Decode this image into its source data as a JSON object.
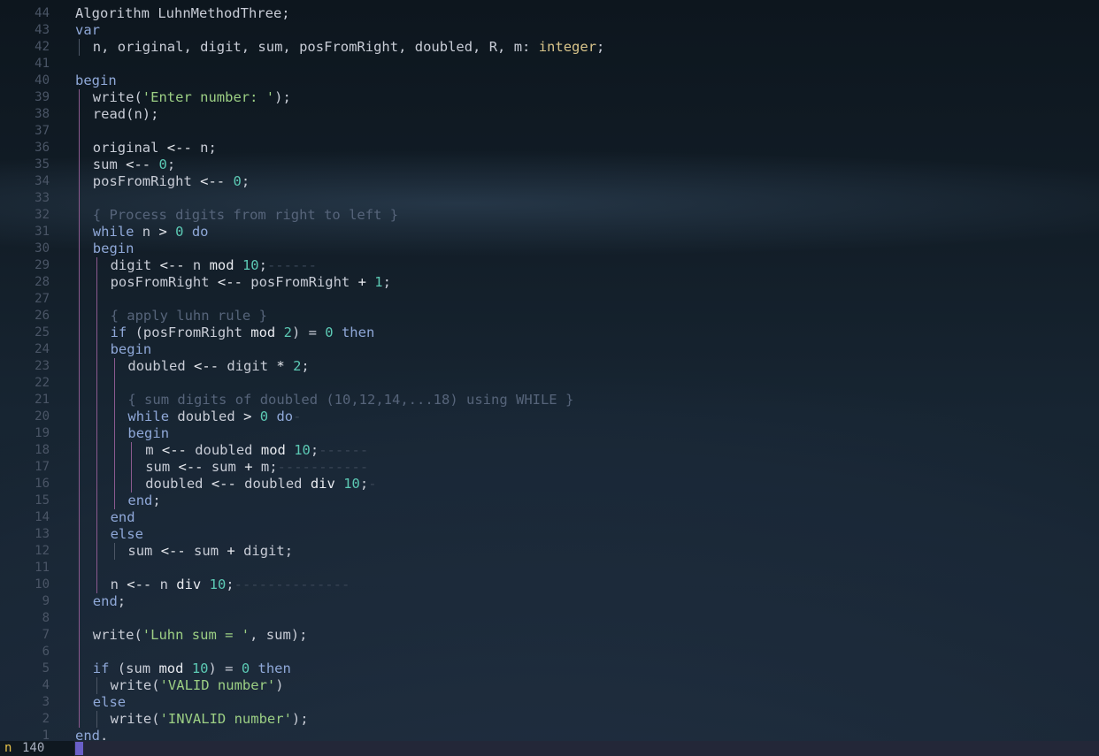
{
  "editor": {
    "lines": [
      {
        "num": "44",
        "indent": 0,
        "guides": [],
        "tokens": [
          [
            "pl",
            "Algorithm LuhnMethodThree;"
          ]
        ]
      },
      {
        "num": "43",
        "indent": 0,
        "guides": [],
        "tokens": [
          [
            "kw",
            "var"
          ]
        ]
      },
      {
        "num": "42",
        "indent": 1,
        "guides": [
          "grey"
        ],
        "tokens": [
          [
            "pl",
            "n, original, digit, sum, posFromRight, doubled, R, m: "
          ],
          [
            "ty",
            "integer"
          ],
          [
            "pl",
            ";"
          ]
        ]
      },
      {
        "num": "41",
        "indent": 0,
        "guides": [],
        "tokens": []
      },
      {
        "num": "40",
        "indent": 0,
        "guides": [],
        "tokens": [
          [
            "kw",
            "begin"
          ]
        ]
      },
      {
        "num": "39",
        "indent": 1,
        "guides": [
          "purple"
        ],
        "tokens": [
          [
            "pl",
            "write("
          ],
          [
            "str",
            "'Enter number: '"
          ],
          [
            "pl",
            ");"
          ]
        ]
      },
      {
        "num": "38",
        "indent": 1,
        "guides": [
          "purple"
        ],
        "tokens": [
          [
            "pl",
            "read(n);"
          ]
        ]
      },
      {
        "num": "37",
        "indent": 1,
        "guides": [
          "purple"
        ],
        "tokens": []
      },
      {
        "num": "36",
        "indent": 1,
        "guides": [
          "purple"
        ],
        "tokens": [
          [
            "pl",
            "original "
          ],
          [
            "op",
            "<--"
          ],
          [
            "pl",
            " n;"
          ]
        ]
      },
      {
        "num": "35",
        "indent": 1,
        "guides": [
          "purple"
        ],
        "tokens": [
          [
            "pl",
            "sum "
          ],
          [
            "op",
            "<--"
          ],
          [
            "pl",
            " "
          ],
          [
            "num",
            "0"
          ],
          [
            "pl",
            ";"
          ]
        ]
      },
      {
        "num": "34",
        "indent": 1,
        "guides": [
          "purple"
        ],
        "tokens": [
          [
            "pl",
            "posFromRight "
          ],
          [
            "op",
            "<--"
          ],
          [
            "pl",
            " "
          ],
          [
            "num",
            "0"
          ],
          [
            "pl",
            ";"
          ]
        ]
      },
      {
        "num": "33",
        "indent": 1,
        "guides": [
          "purple"
        ],
        "tokens": []
      },
      {
        "num": "32",
        "indent": 1,
        "guides": [
          "purple"
        ],
        "tokens": [
          [
            "cm",
            "{ Process digits from right to left }"
          ]
        ]
      },
      {
        "num": "31",
        "indent": 1,
        "guides": [
          "purple"
        ],
        "tokens": [
          [
            "kw",
            "while"
          ],
          [
            "pl",
            " n "
          ],
          [
            "op",
            ">"
          ],
          [
            "pl",
            " "
          ],
          [
            "num",
            "0"
          ],
          [
            "pl",
            " "
          ],
          [
            "kw",
            "do"
          ]
        ]
      },
      {
        "num": "30",
        "indent": 1,
        "guides": [
          "purple"
        ],
        "tokens": [
          [
            "kw",
            "begin"
          ]
        ]
      },
      {
        "num": "29",
        "indent": 2,
        "guides": [
          "purple",
          "purple"
        ],
        "tokens": [
          [
            "pl",
            "digit "
          ],
          [
            "op",
            "<--"
          ],
          [
            "pl",
            " n "
          ],
          [
            "op",
            "mod"
          ],
          [
            "pl",
            " "
          ],
          [
            "num",
            "10"
          ],
          [
            "pl",
            ";"
          ]
        ],
        "trail": "------"
      },
      {
        "num": "28",
        "indent": 2,
        "guides": [
          "purple",
          "purple"
        ],
        "tokens": [
          [
            "pl",
            "posFromRight "
          ],
          [
            "op",
            "<--"
          ],
          [
            "pl",
            " posFromRight "
          ],
          [
            "op",
            "+"
          ],
          [
            "pl",
            " "
          ],
          [
            "num",
            "1"
          ],
          [
            "pl",
            ";"
          ]
        ]
      },
      {
        "num": "27",
        "indent": 2,
        "guides": [
          "purple",
          "purple"
        ],
        "tokens": []
      },
      {
        "num": "26",
        "indent": 2,
        "guides": [
          "purple",
          "purple"
        ],
        "tokens": [
          [
            "cm",
            "{ apply luhn rule }"
          ]
        ]
      },
      {
        "num": "25",
        "indent": 2,
        "guides": [
          "purple",
          "purple"
        ],
        "tokens": [
          [
            "kw",
            "if"
          ],
          [
            "pl",
            " (posFromRight "
          ],
          [
            "op",
            "mod"
          ],
          [
            "pl",
            " "
          ],
          [
            "num",
            "2"
          ],
          [
            "pl",
            ") = "
          ],
          [
            "num",
            "0"
          ],
          [
            "pl",
            " "
          ],
          [
            "kw",
            "then"
          ]
        ]
      },
      {
        "num": "24",
        "indent": 2,
        "guides": [
          "purple",
          "purple"
        ],
        "tokens": [
          [
            "kw",
            "begin"
          ]
        ]
      },
      {
        "num": "23",
        "indent": 3,
        "guides": [
          "purple",
          "purple",
          "purple"
        ],
        "tokens": [
          [
            "pl",
            "doubled "
          ],
          [
            "op",
            "<--"
          ],
          [
            "pl",
            " digit "
          ],
          [
            "op",
            "*"
          ],
          [
            "pl",
            " "
          ],
          [
            "num",
            "2"
          ],
          [
            "pl",
            ";"
          ]
        ]
      },
      {
        "num": "22",
        "indent": 3,
        "guides": [
          "purple",
          "purple",
          "purple"
        ],
        "tokens": []
      },
      {
        "num": "21",
        "indent": 3,
        "guides": [
          "purple",
          "purple",
          "purple"
        ],
        "tokens": [
          [
            "cm",
            "{ sum digits of doubled (10,12,14,...18) using WHILE }"
          ]
        ]
      },
      {
        "num": "20",
        "indent": 3,
        "guides": [
          "purple",
          "purple",
          "purple"
        ],
        "tokens": [
          [
            "kw",
            "while"
          ],
          [
            "pl",
            " doubled "
          ],
          [
            "op",
            ">"
          ],
          [
            "pl",
            " "
          ],
          [
            "num",
            "0"
          ],
          [
            "pl",
            " "
          ],
          [
            "kw",
            "do"
          ]
        ],
        "trail": "-"
      },
      {
        "num": "19",
        "indent": 3,
        "guides": [
          "purple",
          "purple",
          "purple"
        ],
        "tokens": [
          [
            "kw",
            "begin"
          ]
        ]
      },
      {
        "num": "18",
        "indent": 4,
        "guides": [
          "purple",
          "purple",
          "purple",
          "purple"
        ],
        "tokens": [
          [
            "pl",
            "m "
          ],
          [
            "op",
            "<--"
          ],
          [
            "pl",
            " doubled "
          ],
          [
            "op",
            "mod"
          ],
          [
            "pl",
            " "
          ],
          [
            "num",
            "10"
          ],
          [
            "pl",
            ";"
          ]
        ],
        "trail": "------"
      },
      {
        "num": "17",
        "indent": 4,
        "guides": [
          "purple",
          "purple",
          "purple",
          "purple"
        ],
        "tokens": [
          [
            "pl",
            "sum "
          ],
          [
            "op",
            "<--"
          ],
          [
            "pl",
            " sum "
          ],
          [
            "op",
            "+"
          ],
          [
            "pl",
            " m;"
          ]
        ],
        "trail": "-----------"
      },
      {
        "num": "16",
        "indent": 4,
        "guides": [
          "purple",
          "purple",
          "purple",
          "purple"
        ],
        "tokens": [
          [
            "pl",
            "doubled "
          ],
          [
            "op",
            "<--"
          ],
          [
            "pl",
            " doubled "
          ],
          [
            "op",
            "div"
          ],
          [
            "pl",
            " "
          ],
          [
            "num",
            "10"
          ],
          [
            "pl",
            ";"
          ]
        ],
        "trail": "-"
      },
      {
        "num": "15",
        "indent": 3,
        "guides": [
          "purple",
          "purple",
          "purple"
        ],
        "tokens": [
          [
            "kw",
            "end"
          ],
          [
            "pl",
            ";"
          ]
        ]
      },
      {
        "num": "14",
        "indent": 2,
        "guides": [
          "purple",
          "purple"
        ],
        "tokens": [
          [
            "kw",
            "end"
          ]
        ]
      },
      {
        "num": "13",
        "indent": 2,
        "guides": [
          "purple",
          "purple"
        ],
        "tokens": [
          [
            "kw",
            "else"
          ]
        ]
      },
      {
        "num": "12",
        "indent": 3,
        "guides": [
          "purple",
          "purple",
          "grey"
        ],
        "tokens": [
          [
            "pl",
            "sum "
          ],
          [
            "op",
            "<--"
          ],
          [
            "pl",
            " sum "
          ],
          [
            "op",
            "+"
          ],
          [
            "pl",
            " digit;"
          ]
        ]
      },
      {
        "num": "11",
        "indent": 2,
        "guides": [
          "purple",
          "purple"
        ],
        "tokens": []
      },
      {
        "num": "10",
        "indent": 2,
        "guides": [
          "purple",
          "purple"
        ],
        "tokens": [
          [
            "pl",
            "n "
          ],
          [
            "op",
            "<--"
          ],
          [
            "pl",
            " n "
          ],
          [
            "op",
            "div"
          ],
          [
            "pl",
            " "
          ],
          [
            "num",
            "10"
          ],
          [
            "pl",
            ";"
          ]
        ],
        "trail": "--------------"
      },
      {
        "num": "9",
        "indent": 1,
        "guides": [
          "purple"
        ],
        "tokens": [
          [
            "kw",
            "end"
          ],
          [
            "pl",
            ";"
          ]
        ]
      },
      {
        "num": "8",
        "indent": 1,
        "guides": [
          "purple"
        ],
        "tokens": []
      },
      {
        "num": "7",
        "indent": 1,
        "guides": [
          "purple"
        ],
        "tokens": [
          [
            "pl",
            "write("
          ],
          [
            "str",
            "'Luhn sum = '"
          ],
          [
            "pl",
            ", sum);"
          ]
        ]
      },
      {
        "num": "6",
        "indent": 1,
        "guides": [
          "purple"
        ],
        "tokens": []
      },
      {
        "num": "5",
        "indent": 1,
        "guides": [
          "purple"
        ],
        "tokens": [
          [
            "kw",
            "if"
          ],
          [
            "pl",
            " (sum "
          ],
          [
            "op",
            "mod"
          ],
          [
            "pl",
            " "
          ],
          [
            "num",
            "10"
          ],
          [
            "pl",
            ") = "
          ],
          [
            "num",
            "0"
          ],
          [
            "pl",
            " "
          ],
          [
            "kw",
            "then"
          ]
        ]
      },
      {
        "num": "4",
        "indent": 2,
        "guides": [
          "purple",
          "grey"
        ],
        "tokens": [
          [
            "pl",
            "write("
          ],
          [
            "str",
            "'VALID number'"
          ],
          [
            "pl",
            ")"
          ]
        ]
      },
      {
        "num": "3",
        "indent": 1,
        "guides": [
          "purple"
        ],
        "tokens": [
          [
            "kw",
            "else"
          ]
        ]
      },
      {
        "num": "2",
        "indent": 2,
        "guides": [
          "purple",
          "grey"
        ],
        "tokens": [
          [
            "pl",
            "write("
          ],
          [
            "str",
            "'INVALID number'"
          ],
          [
            "pl",
            ");"
          ]
        ]
      },
      {
        "num": "1",
        "indent": 0,
        "guides": [],
        "tokens": [
          [
            "kw",
            "end"
          ],
          [
            "pl",
            "."
          ]
        ]
      }
    ]
  },
  "statusbar": {
    "mode_letter": "n",
    "current_line": "140"
  },
  "colors": {
    "keyword": "#8fa8d8",
    "type": "#d8c48a",
    "string": "#9ccf84",
    "number": "#5cc9b4",
    "comment": "#56647a",
    "guide_purple": "#8b5a8f",
    "cursor": "#6a5fc8",
    "mode_letter": "#e8c44a"
  }
}
